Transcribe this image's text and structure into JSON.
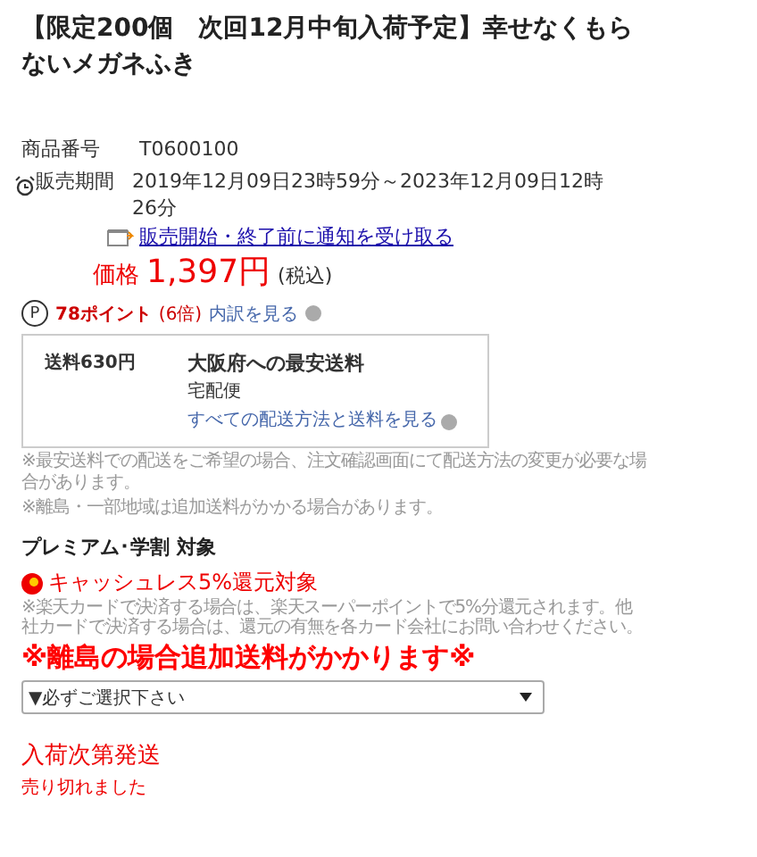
{
  "title": "【限定200個　次回12月中旬入荷予定】幸せなくもらないメガネふき",
  "item_number": {
    "label": "商品番号",
    "value": "T0600100"
  },
  "sale_period": {
    "label": "販売期間",
    "value": "2019年12月09日23時59分～2023年12月09日12時26分"
  },
  "notify_link": "販売開始・終了前に通知を受け取る",
  "price": {
    "label": "価格",
    "value": "1,397円",
    "tax": "(税込)"
  },
  "points": {
    "icon": "P",
    "amount": "78ポイント",
    "multiplier": "(6倍)",
    "link": "内訳を見る"
  },
  "shipping": {
    "fee": "送料630円",
    "heading": "大阪府への最安送料",
    "method": "宅配便",
    "link": "すべての配送方法と送料を見る"
  },
  "notes": [
    "※最安送料での配送をご希望の場合、注文確認画面にて配送方法の変更が必要な場合があります。",
    "※離島・一部地域は追加送料がかかる場合があります。"
  ],
  "premium": "プレミアム･学割 対象",
  "cashless": {
    "label": "キャッシュレス5%還元対象",
    "note": "※楽天カードで決済する場合は、楽天スーパーポイントで5%分還元されます。他社カードで決済する場合は、還元の有無を各カード会社にお問い合わせください。"
  },
  "island_notice": "※離島の場合追加送料がかかります※",
  "select": {
    "value": "▼必ずご選択下さい"
  },
  "stock_status": "入荷次第発送",
  "sold_out": "売り切れました"
}
